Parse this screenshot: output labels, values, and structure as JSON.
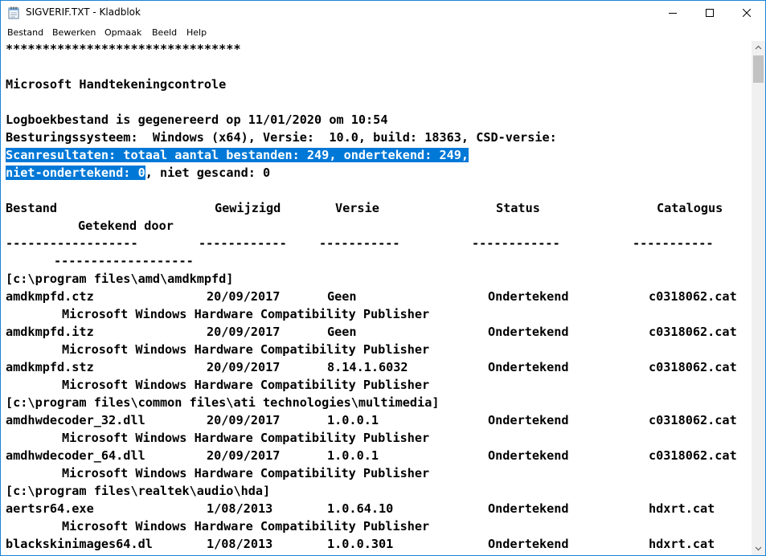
{
  "window": {
    "title": "SIGVERIF.TXT - Kladblok",
    "icon": "notepad-icon"
  },
  "menu": [
    "Bestand",
    "Bewerken",
    "Opmaak",
    "Beeld",
    "Help"
  ],
  "text": {
    "stars": "********************************",
    "heading": "Microsoft Handtekeningcontrole",
    "generated": "Logboekbestand is gegenereerd op 11/01/2020 om 10:54",
    "os": "Besturingssysteem:  Windows (x64), Versie:  10.0, build: 18363, CSD-versie:",
    "scan1": "Scanresultaten: totaal aantal bestanden: 249, ondertekend: 249,",
    "scan2_sel": "niet-ondertekend: 0",
    "scan2_rest": ", niet gescand: 0"
  },
  "table_header": {
    "bestand": "Bestand",
    "gewijzigd": "Gewijzigd",
    "versie": "Versie",
    "status": "Status",
    "catalogus": "Catalogus",
    "getekend": "Getekend door"
  },
  "dashes": {
    "c1": "------------------",
    "c2": "------------",
    "c3": "-----------",
    "c4": "------------",
    "c5": "-----------",
    "c6": "-------------------"
  },
  "lines": [
    {
      "type": "dir",
      "text": "[c:\\program files\\amd\\amdkmpfd]"
    },
    {
      "type": "file",
      "name": "amdkmpfd.ctz",
      "date": "20/09/2017",
      "version": "Geen",
      "status": "Ondertekend",
      "catalog": "c0318062.cat"
    },
    {
      "type": "signer",
      "text": "Microsoft Windows Hardware Compatibility Publisher"
    },
    {
      "type": "file",
      "name": "amdkmpfd.itz",
      "date": "20/09/2017",
      "version": "Geen",
      "status": "Ondertekend",
      "catalog": "c0318062.cat"
    },
    {
      "type": "signer",
      "text": "Microsoft Windows Hardware Compatibility Publisher"
    },
    {
      "type": "file",
      "name": "amdkmpfd.stz",
      "date": "20/09/2017",
      "version": "8.14.1.6032",
      "status": "Ondertekend",
      "catalog": "c0318062.cat"
    },
    {
      "type": "signer",
      "text": "Microsoft Windows Hardware Compatibility Publisher"
    },
    {
      "type": "dir",
      "text": "[c:\\program files\\common files\\ati technologies\\multimedia]"
    },
    {
      "type": "file",
      "name": "amdhwdecoder_32.dll",
      "date": "20/09/2017",
      "version": "1.0.0.1",
      "status": "Ondertekend",
      "catalog": "c0318062.cat"
    },
    {
      "type": "signer",
      "text": "Microsoft Windows Hardware Compatibility Publisher"
    },
    {
      "type": "file",
      "name": "amdhwdecoder_64.dll",
      "date": "20/09/2017",
      "version": "1.0.0.1",
      "status": "Ondertekend",
      "catalog": "c0318062.cat"
    },
    {
      "type": "signer",
      "text": "Microsoft Windows Hardware Compatibility Publisher"
    },
    {
      "type": "dir",
      "text": "[c:\\program files\\realtek\\audio\\hda]"
    },
    {
      "type": "file",
      "name": "aertsr64.exe",
      "date": "1/08/2013",
      "version": "1.0.64.10",
      "status": "Ondertekend",
      "catalog": "hdxrt.cat"
    },
    {
      "type": "signer",
      "text": "Microsoft Windows Hardware Compatibility Publisher"
    },
    {
      "type": "file",
      "name": "blackskinimages64.dl",
      "date": "1/08/2013",
      "version": "1.0.0.301",
      "status": "Ondertekend",
      "catalog": "hdxrt.cat"
    }
  ]
}
